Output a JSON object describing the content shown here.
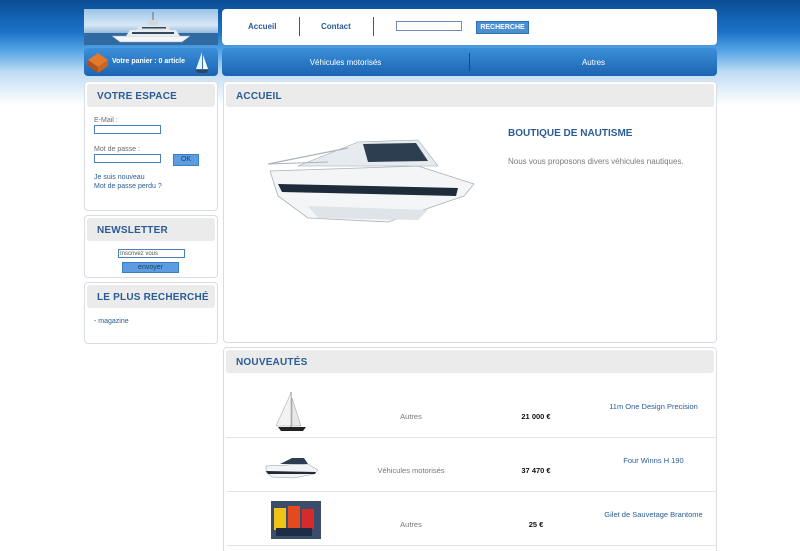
{
  "header": {
    "nav": [
      {
        "label": "Accueil"
      },
      {
        "label": "Contact"
      }
    ],
    "search": {
      "value": "",
      "button_label": "RECHERCHE"
    }
  },
  "cart": {
    "label": "Votre panier : 0 article"
  },
  "menu": [
    {
      "label": "Véhicules motorisés"
    },
    {
      "label": "Autres"
    }
  ],
  "sidebar": {
    "account": {
      "title": "VOTRE ESPACE",
      "email_label": "E-Mail :",
      "password_label": "Mot de passe :",
      "ok_label": "OK",
      "register_link": "Je suis nouveau",
      "forgot_link": "Mot de passe perdu ?"
    },
    "newsletter": {
      "title": "NEWSLETTER",
      "input_value": "Inscrivez vous",
      "button_label": "envoyer"
    },
    "popular": {
      "title": "LE PLUS RECHERCHÉ",
      "items": [
        {
          "label": "- magazine"
        }
      ]
    }
  },
  "main": {
    "home": {
      "title": "ACCUEIL",
      "shop_title": "BOUTIQUE DE NAUTISME",
      "shop_desc": "Nous vous proposons divers véhicules nautiques."
    },
    "news": {
      "title": "NOUVEAUTÉS",
      "items": [
        {
          "category": "Autres",
          "price": "21 000 €",
          "name": "11m One Design Precision",
          "icon": "sailboat-image"
        },
        {
          "category": "Véhicules motorisés",
          "price": "37 470 €",
          "name": "Four Winns H 190",
          "icon": "motorboat-image"
        },
        {
          "category": "Autres",
          "price": "25 €",
          "name": "Gilet de Sauvetage Brantome",
          "icon": "life-jacket-image"
        }
      ]
    }
  },
  "colors": {
    "accent": "#2a5c95",
    "bar": "#1c64b2"
  }
}
